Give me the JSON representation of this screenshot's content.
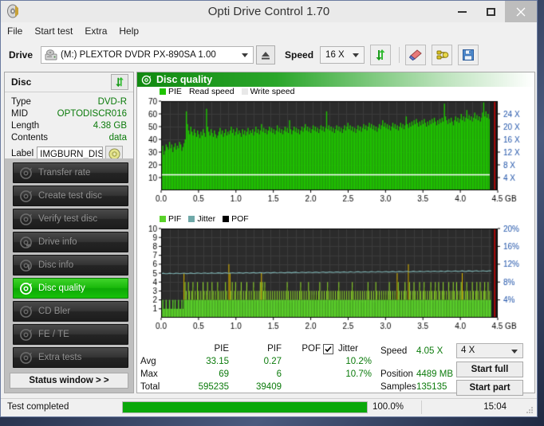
{
  "window": {
    "title": "Opti Drive Control 1.70",
    "app_icon": "disc-icon",
    "minimize": "–",
    "maximize": "□",
    "close": "×"
  },
  "menu": [
    {
      "label": "File"
    },
    {
      "label": "Start test"
    },
    {
      "label": "Extra"
    },
    {
      "label": "Help"
    }
  ],
  "toolbar": {
    "drive_label": "Drive",
    "drive_value": "(M:)  PLEXTOR DVDR   PX-890SA 1.00",
    "eject_icon": "eject-icon",
    "speed_label": "Speed",
    "speed_value": "16 X",
    "refresh_icon": "refresh-icon",
    "erase_icon": "eraser-icon",
    "plug_icon": "plug-icon",
    "save_icon": "save-icon"
  },
  "disc_panel": {
    "title": "Disc",
    "refresh_icon": "refresh-icon",
    "rows": [
      {
        "key": "Type",
        "value": "DVD-R"
      },
      {
        "key": "MID",
        "value": "OPTODISCR016"
      },
      {
        "key": "Length",
        "value": "4.38 GB"
      },
      {
        "key": "Contents",
        "value": "data"
      }
    ],
    "label_key": "Label",
    "label_value": "IMGBURN_DIS",
    "label_button_icon": "disc-icon"
  },
  "nav": {
    "items": [
      {
        "label": "Transfer rate",
        "icon": "disc-icon",
        "active": false
      },
      {
        "label": "Create test disc",
        "icon": "disc-icon",
        "active": false
      },
      {
        "label": "Verify test disc",
        "icon": "disc-icon",
        "active": false
      },
      {
        "label": "Drive info",
        "icon": "disc-icon",
        "active": false
      },
      {
        "label": "Disc info",
        "icon": "disc-icon",
        "active": false
      },
      {
        "label": "Disc quality",
        "icon": "disc-icon",
        "active": true
      },
      {
        "label": "CD Bler",
        "icon": "disc-icon",
        "active": false
      },
      {
        "label": "FE / TE",
        "icon": "disc-icon",
        "active": false
      },
      {
        "label": "Extra tests",
        "icon": "disc-icon",
        "active": false
      }
    ],
    "status_window_button": "Status window > >"
  },
  "panel": {
    "title": "Disc quality",
    "icon": "disc-icon"
  },
  "stats": {
    "col_headers": [
      "PIE",
      "PIF",
      "POF",
      "Jitter"
    ],
    "row_labels": [
      "Avg",
      "Max",
      "Total"
    ],
    "pie": {
      "avg": "33.15",
      "max": "69",
      "total": "595235"
    },
    "pif": {
      "avg": "0.27",
      "max": "6",
      "total": "39409"
    },
    "pof": {
      "avg": "",
      "max": "",
      "total": ""
    },
    "jitter": {
      "avg": "10.2%",
      "max": "10.7%",
      "total": "",
      "enabled": true
    },
    "speed_key": "Speed",
    "speed_value": "4.05 X",
    "position_key": "Position",
    "position_value": "4489 MB",
    "samples_key": "Samples",
    "samples_value": "135135",
    "speed_select": "4 X",
    "start_full": "Start full",
    "start_part": "Start part"
  },
  "statusbar": {
    "text": "Test completed",
    "progress_pct": "100.0%",
    "progress_value": 100,
    "time": "15:04"
  },
  "colors": {
    "pie_green": "#1fc400",
    "pif_green": "#5ad22a",
    "jitter_teal": "#6fa8a8",
    "pof_black": "#000000",
    "accent": "#16b80a",
    "plot_bg": "#2b2b2b",
    "axis_blue": "#2255aa",
    "value_green": "#0a7a0a",
    "marker_red": "#e00000"
  },
  "chart_data": [
    {
      "type": "bar",
      "name": "pie-chart",
      "title": "Disc quality",
      "xlabel": "GB",
      "ylabel": "PIE",
      "xlim": [
        0.0,
        4.5
      ],
      "ylim": [
        0,
        70
      ],
      "xticks": [
        "0.0",
        "0.5",
        "1.0",
        "1.5",
        "2.0",
        "2.5",
        "3.0",
        "3.5",
        "4.0",
        "4.5 GB"
      ],
      "yticks": [
        10,
        20,
        30,
        40,
        50,
        60,
        70
      ],
      "y2ticks": [
        "4 X",
        "8 X",
        "12 X",
        "16 X",
        "20 X",
        "24 X"
      ],
      "y2lim": [
        0,
        28
      ],
      "legend": [
        {
          "label": "PIE",
          "color": "#1fc400"
        },
        {
          "label": "Read speed",
          "color": "#ffffff"
        },
        {
          "label": "Write speed",
          "color": "#e8e8e8"
        }
      ],
      "legend_position": "top-left",
      "grid": true,
      "read_speed_line": 12.2,
      "marker_x": 4.46,
      "values": [
        30,
        35,
        28,
        31,
        36,
        34,
        32,
        38,
        33,
        36,
        30,
        34,
        37,
        32,
        35,
        33,
        38,
        36,
        31,
        34,
        37,
        40,
        62,
        52,
        47,
        44,
        50,
        46,
        43,
        48,
        45,
        42,
        47,
        44,
        41,
        46,
        43,
        48,
        45,
        42,
        64,
        50,
        46,
        43,
        48,
        45,
        42,
        47,
        44,
        41,
        43,
        46,
        49,
        44,
        47,
        42,
        45,
        48,
        43,
        46,
        44,
        47,
        50,
        45,
        48,
        43,
        46,
        49,
        44,
        47,
        45,
        42,
        48,
        44,
        47,
        43,
        46,
        49,
        44,
        47,
        45,
        48,
        43,
        46,
        50,
        45,
        48,
        44,
        47,
        52,
        46,
        49,
        45,
        48,
        44,
        47,
        50,
        46,
        49,
        45,
        48,
        44,
        47,
        51,
        46,
        49,
        45,
        48,
        44,
        47,
        50,
        46,
        49,
        45,
        55,
        48,
        44,
        47,
        50,
        46,
        49,
        45,
        48,
        44,
        47,
        50,
        46,
        49,
        52,
        47,
        50,
        46,
        49,
        45,
        48,
        51,
        47,
        50,
        46,
        49,
        45,
        48,
        51,
        47,
        50,
        46,
        49,
        62,
        48,
        51,
        47,
        50,
        46,
        49,
        45,
        48,
        51,
        47,
        50,
        46,
        49,
        45,
        48,
        51,
        47,
        50,
        53,
        48,
        51,
        47,
        50,
        46,
        49,
        45,
        48,
        51,
        47,
        50,
        46,
        49,
        52,
        48,
        51,
        47,
        50,
        53,
        49,
        52,
        48,
        51,
        47,
        50,
        46,
        49,
        52,
        48,
        51,
        55,
        50,
        53,
        49,
        52,
        48,
        51,
        47,
        50,
        53,
        49,
        52,
        48,
        51,
        47,
        50,
        53,
        49,
        52,
        48,
        51,
        58,
        52,
        49,
        53,
        50,
        54,
        51,
        55,
        52,
        56,
        53,
        50,
        54,
        51,
        55,
        52,
        56,
        53,
        50,
        54,
        51,
        55,
        52,
        56,
        53,
        57,
        54,
        51,
        55,
        52,
        56,
        53,
        57,
        54,
        68,
        58,
        55,
        52,
        56,
        53,
        57,
        54,
        51,
        55,
        58,
        54,
        57,
        53,
        56,
        60,
        55,
        58,
        54,
        57,
        63,
        56,
        59,
        55,
        58,
        54,
        57,
        61,
        56,
        59,
        55,
        58,
        54,
        57,
        61,
        69,
        58,
        62,
        57,
        60,
        56,
        59,
        63,
        58,
        61,
        57,
        60,
        64
      ]
    },
    {
      "type": "bar",
      "name": "pif-chart",
      "xlabel": "GB",
      "ylabel": "PIF",
      "xlim": [
        0.0,
        4.5
      ],
      "ylim": [
        0,
        10
      ],
      "xticks": [
        "0.0",
        "0.5",
        "1.0",
        "1.5",
        "2.0",
        "2.5",
        "3.0",
        "3.5",
        "4.0",
        "4.5 GB"
      ],
      "yticks": [
        1,
        2,
        3,
        4,
        5,
        6,
        7,
        8,
        9,
        10
      ],
      "y2ticks": [
        "4%",
        "8%",
        "12%",
        "16%",
        "20%"
      ],
      "y2lim": [
        0,
        20
      ],
      "legend": [
        {
          "label": "PIF",
          "color": "#5ad22a"
        },
        {
          "label": "Jitter",
          "color": "#6fa8a8"
        },
        {
          "label": "POF",
          "color": "#000000"
        }
      ],
      "legend_position": "top-left",
      "grid": true,
      "jitter_line_start": 9.9,
      "jitter_line_end": 10.5,
      "marker_x": 4.46,
      "values": [
        1,
        2,
        1,
        1,
        2,
        1,
        1,
        2,
        1,
        1,
        2,
        1,
        2,
        1,
        1,
        2,
        1,
        1,
        2,
        1,
        5,
        4,
        3,
        2,
        4,
        3,
        2,
        3,
        4,
        2,
        3,
        2,
        4,
        3,
        2,
        3,
        2,
        4,
        3,
        2,
        3,
        4,
        2,
        3,
        2,
        4,
        3,
        2,
        3,
        2,
        4,
        3,
        2,
        3,
        2,
        3,
        2,
        4,
        3,
        2,
        6,
        5,
        3,
        4,
        2,
        3,
        4,
        2,
        3,
        2,
        3,
        4,
        2,
        3,
        2,
        3,
        4,
        2,
        3,
        2,
        3,
        2,
        4,
        3,
        2,
        3,
        2,
        3,
        4,
        5,
        4,
        3,
        4,
        3,
        2,
        3,
        2,
        3,
        2,
        3,
        2,
        3,
        2,
        3,
        2,
        3,
        2,
        3,
        2,
        3,
        2,
        3,
        4,
        3,
        2,
        3,
        2,
        3,
        2,
        3,
        2,
        3,
        2,
        3,
        4,
        3,
        2,
        3,
        2,
        3,
        2,
        4,
        3,
        2,
        3,
        2,
        3,
        2,
        3,
        2,
        3,
        4,
        2,
        3,
        2,
        3,
        2,
        3,
        4,
        3,
        2,
        3,
        2,
        3,
        2,
        3,
        2,
        3,
        4,
        3,
        2,
        3,
        2,
        3,
        2,
        3,
        2,
        3,
        2,
        3,
        4,
        3,
        2,
        3,
        2,
        3,
        2,
        3,
        2,
        3,
        2,
        3,
        2,
        3,
        4,
        3,
        2,
        3,
        2,
        3,
        2,
        4,
        3,
        2,
        3,
        2,
        3,
        2,
        3,
        2,
        3,
        2,
        3,
        4,
        3,
        2,
        3,
        2,
        3,
        2,
        5,
        4,
        3,
        2,
        3,
        2,
        3,
        4,
        3,
        2,
        6,
        4,
        3,
        2,
        3,
        4,
        3,
        2,
        3,
        2,
        4,
        3,
        2,
        3,
        4,
        3,
        2,
        3,
        2,
        3,
        4,
        3,
        2,
        3,
        4,
        3,
        2,
        4,
        3,
        2,
        3,
        4,
        3,
        2,
        3,
        2,
        4,
        3,
        2,
        3,
        4,
        3,
        2,
        4,
        3,
        2,
        3,
        4,
        5,
        3,
        2,
        3,
        4,
        3,
        2,
        3,
        2,
        4,
        3,
        2,
        3,
        4,
        3,
        2,
        4,
        3,
        2,
        3,
        4,
        3,
        2,
        4,
        3,
        2,
        3,
        4,
        3,
        2,
        3,
        4
      ]
    }
  ]
}
